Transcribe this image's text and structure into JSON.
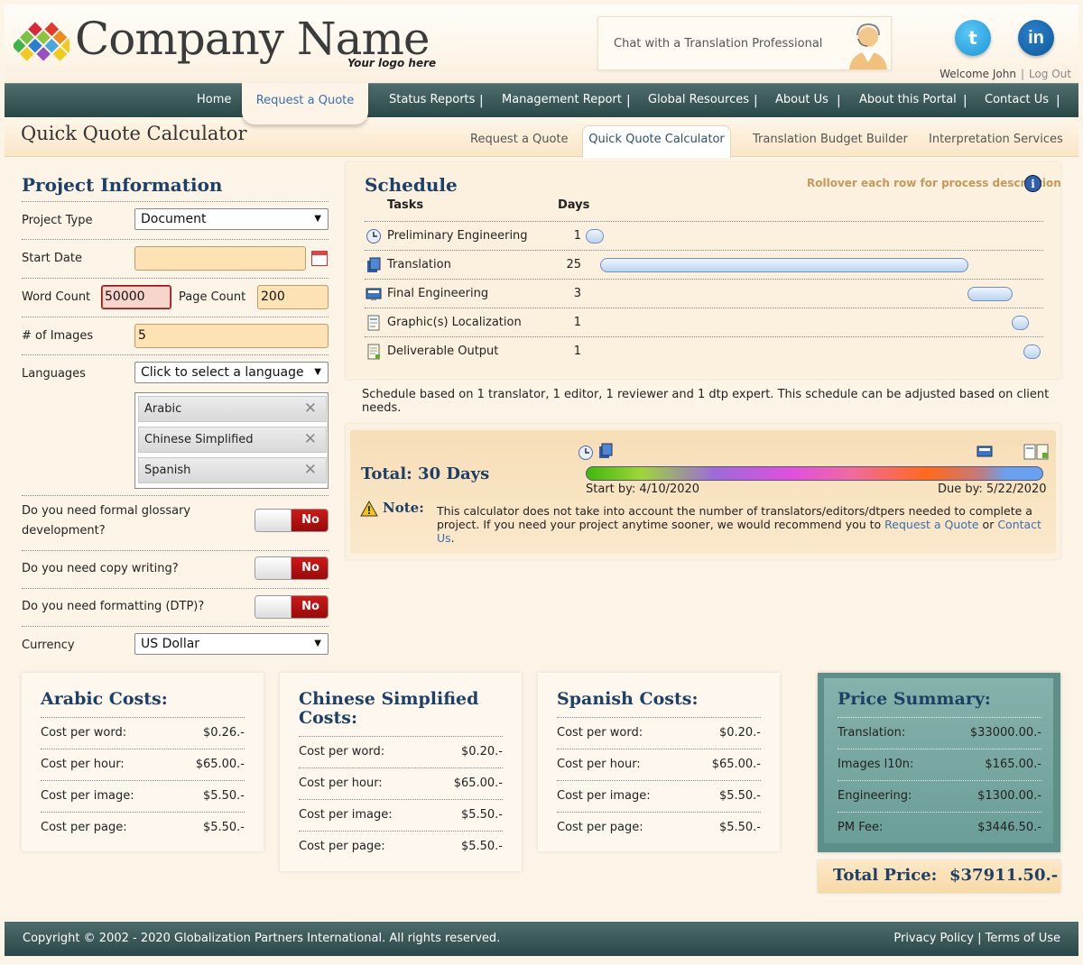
{
  "header": {
    "company_name": "Company Name",
    "logo_tagline": "Your logo here",
    "chat_text": "Chat with a Translation Professional",
    "welcome": "Welcome John",
    "logout": "Log Out",
    "twitter_glyph": "t",
    "linkedin_glyph": "in"
  },
  "nav": {
    "items": [
      "Home",
      "Request a Quote",
      "Status Reports",
      "Management Report",
      "Global Resources",
      "About Us",
      "About this Portal",
      "Contact Us"
    ],
    "active": "Request a Quote"
  },
  "subnav": {
    "page_title": "Quick Quote Calculator",
    "tabs": [
      "Request a Quote",
      "Quick Quote Calculator",
      "Translation Budget Builder",
      "Interpretation Services"
    ],
    "active": "Quick Quote Calculator"
  },
  "project": {
    "title": "Project Information",
    "project_type_label": "Project Type",
    "project_type_value": "Document",
    "start_date_label": "Start Date",
    "start_date_value": "",
    "word_count_label": "Word Count",
    "word_count_value": "50000",
    "page_count_label": "Page Count",
    "page_count_value": "200",
    "images_label": "# of Images",
    "images_value": "5",
    "languages_label": "Languages",
    "languages_placeholder": "Click to select a language",
    "selected_languages": [
      "Arabic",
      "Chinese Simplified",
      "Spanish"
    ],
    "glossary_q": "Do you need formal glossary development?",
    "copywriting_q": "Do you need copy writing?",
    "formatting_q": "Do you need formatting (DTP)?",
    "toggle_value": "No",
    "currency_label": "Currency",
    "currency_value": "US Dollar"
  },
  "schedule": {
    "title": "Schedule",
    "rollover": "Rollover each row for process description",
    "col_tasks": "Tasks",
    "col_days": "Days",
    "tasks": [
      {
        "name": "Preliminary Engineering",
        "days": "1"
      },
      {
        "name": "Translation",
        "days": "25"
      },
      {
        "name": "Final Engineering",
        "days": "3"
      },
      {
        "name": "Graphic(s) Localization",
        "days": "1"
      },
      {
        "name": "Deliverable Output",
        "days": "1"
      }
    ],
    "note": "Schedule based on 1 translator, 1 editor, 1 reviewer and 1 dtp expert. This schedule can be adjusted based on client needs."
  },
  "total": {
    "label": "Total: 30 Days",
    "start_by": "Start by: 4/10/2020",
    "due_by": "Due by: 5/22/2020",
    "note_label": "Note:",
    "note_text": "This calculator does not take into account the number of translators/editors/dtpers needed to complete a project. If you need your project anytime sooner, we would recommend you to",
    "link_quote": "Request a Quote",
    "or": "or",
    "link_contact": "Contact Us",
    "end": "."
  },
  "costs": [
    {
      "title": "Arabic Costs:",
      "rows": [
        [
          "Cost per word:",
          "$0.26.-"
        ],
        [
          "Cost per hour:",
          "$65.00.-"
        ],
        [
          "Cost per image:",
          "$5.50.-"
        ],
        [
          "Cost per page:",
          "$5.50.-"
        ]
      ]
    },
    {
      "title": "Chinese Simplified Costs:",
      "rows": [
        [
          "Cost per word:",
          "$0.20.-"
        ],
        [
          "Cost per hour:",
          "$65.00.-"
        ],
        [
          "Cost per image:",
          "$5.50.-"
        ],
        [
          "Cost per page:",
          "$5.50.-"
        ]
      ]
    },
    {
      "title": "Spanish Costs:",
      "rows": [
        [
          "Cost per word:",
          "$0.20.-"
        ],
        [
          "Cost per hour:",
          "$65.00.-"
        ],
        [
          "Cost per image:",
          "$5.50.-"
        ],
        [
          "Cost per page:",
          "$5.50.-"
        ]
      ]
    }
  ],
  "summary": {
    "title": "Price Summary:",
    "rows": [
      [
        "Translation:",
        "$33000.00.-"
      ],
      [
        "Images l10n:",
        "$165.00.-"
      ],
      [
        "Engineering:",
        "$1300.00.-"
      ],
      [
        "PM Fee:",
        "$3446.50.-"
      ]
    ],
    "total_label": "Total Price:",
    "total_value": "$37911.50.-"
  },
  "footer": {
    "copyright": "Copyright © 2002 - 2020 Globalization Partners International. All rights reserved.",
    "privacy": "Privacy Policy",
    "terms": "Terms of Use"
  },
  "colors": {
    "nav": "#2b4848",
    "heading": "#1e3f66",
    "link": "#3a6fb0",
    "toggle_no": "#c01010"
  }
}
